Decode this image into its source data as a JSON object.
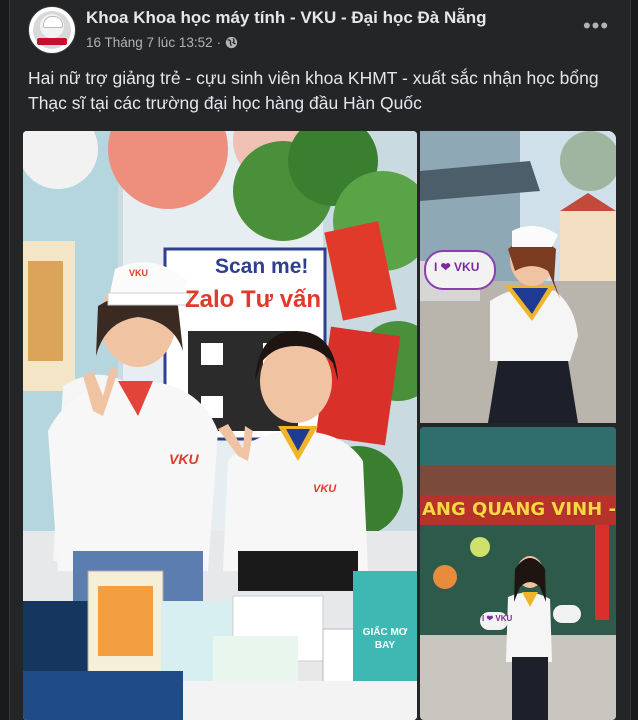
{
  "post": {
    "page_name": "Khoa Khoa học máy tính - VKU - Đại học Đà Nẵng",
    "timestamp": "16 Tháng 7 lúc 13:52",
    "separator": "·",
    "privacy_icon": "globe-icon",
    "more_icon": "more-horizontal-icon",
    "more_label": "•••",
    "text": "Hai nữ trợ giảng trẻ - cựu sinh viên khoa KHMT - xuất sắc nhận học bổng Thạc sĩ tại các trường đại học hàng đầu Hàn Quốc"
  },
  "photos": {
    "main": {
      "sign_line1": "Scan me!",
      "sign_line2": "Zalo Tư vấn",
      "shirt_logo": "VKU",
      "cap_logo": "VKU",
      "product_label": "GIẤC MƠ BAY"
    },
    "top_right": {
      "heart_sign": "I ❤ VKU"
    },
    "bottom_right": {
      "banner": "ANG QUANG VINH - M",
      "heart_sign": "I ❤ VKU"
    }
  },
  "colors": {
    "background": "#18191a",
    "card": "#242526",
    "text_primary": "#e4e6eb",
    "text_secondary": "#b0b3b8"
  }
}
